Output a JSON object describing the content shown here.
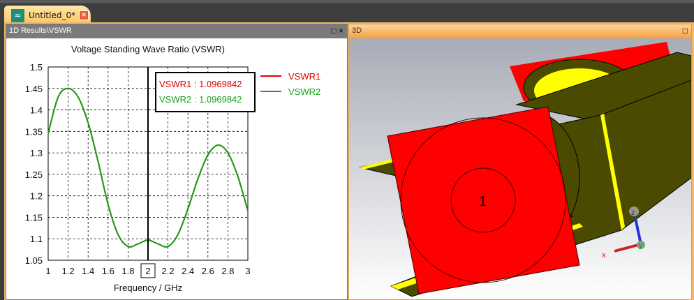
{
  "tab": {
    "title": "Untitled_0*",
    "icon": "wave-icon",
    "close": "×"
  },
  "left_panel": {
    "title": "1D Results\\VSWR",
    "maximize": "□",
    "close": "×"
  },
  "right_panel": {
    "title": "3D",
    "maximize": "□",
    "port_label": "1",
    "axes": {
      "x": "x",
      "y": "y",
      "z": "z"
    }
  },
  "chart_data": {
    "type": "line",
    "title": "Voltage Standing Wave Ratio (VSWR)",
    "xlabel": "Frequency / GHz",
    "ylabel": "",
    "xlim": [
      1,
      3
    ],
    "ylim": [
      1.05,
      1.5
    ],
    "xticks": [
      "1",
      "1.2",
      "1.4",
      "1.6",
      "1.8",
      "2",
      "2.2",
      "2.4",
      "2.6",
      "2.8",
      "3"
    ],
    "yticks": [
      "1.05",
      "1.1",
      "1.15",
      "1.2",
      "1.25",
      "1.3",
      "1.35",
      "1.4",
      "1.45",
      "1.5"
    ],
    "grid": true,
    "legend_position": "right",
    "marker": {
      "x": 2,
      "label": "2",
      "readouts": [
        "VSWR1 : 1.0969842",
        "VSWR2 : 1.0969842"
      ]
    },
    "x": [
      1.0,
      1.1,
      1.2,
      1.3,
      1.4,
      1.5,
      1.6,
      1.7,
      1.8,
      1.9,
      2.0,
      2.1,
      2.2,
      2.3,
      2.4,
      2.5,
      2.6,
      2.7,
      2.8,
      2.9,
      3.0
    ],
    "series": [
      {
        "name": "VSWR1",
        "color": "#e00000",
        "values": [
          1.345,
          1.43,
          1.45,
          1.43,
          1.37,
          1.28,
          1.18,
          1.11,
          1.082,
          1.088,
          1.097,
          1.088,
          1.082,
          1.11,
          1.17,
          1.24,
          1.295,
          1.318,
          1.3,
          1.245,
          1.165
        ]
      },
      {
        "name": "VSWR2",
        "color": "#1aa01a",
        "values": [
          1.345,
          1.43,
          1.45,
          1.43,
          1.37,
          1.28,
          1.18,
          1.11,
          1.082,
          1.088,
          1.097,
          1.088,
          1.082,
          1.11,
          1.17,
          1.24,
          1.295,
          1.318,
          1.3,
          1.245,
          1.165
        ]
      }
    ]
  }
}
